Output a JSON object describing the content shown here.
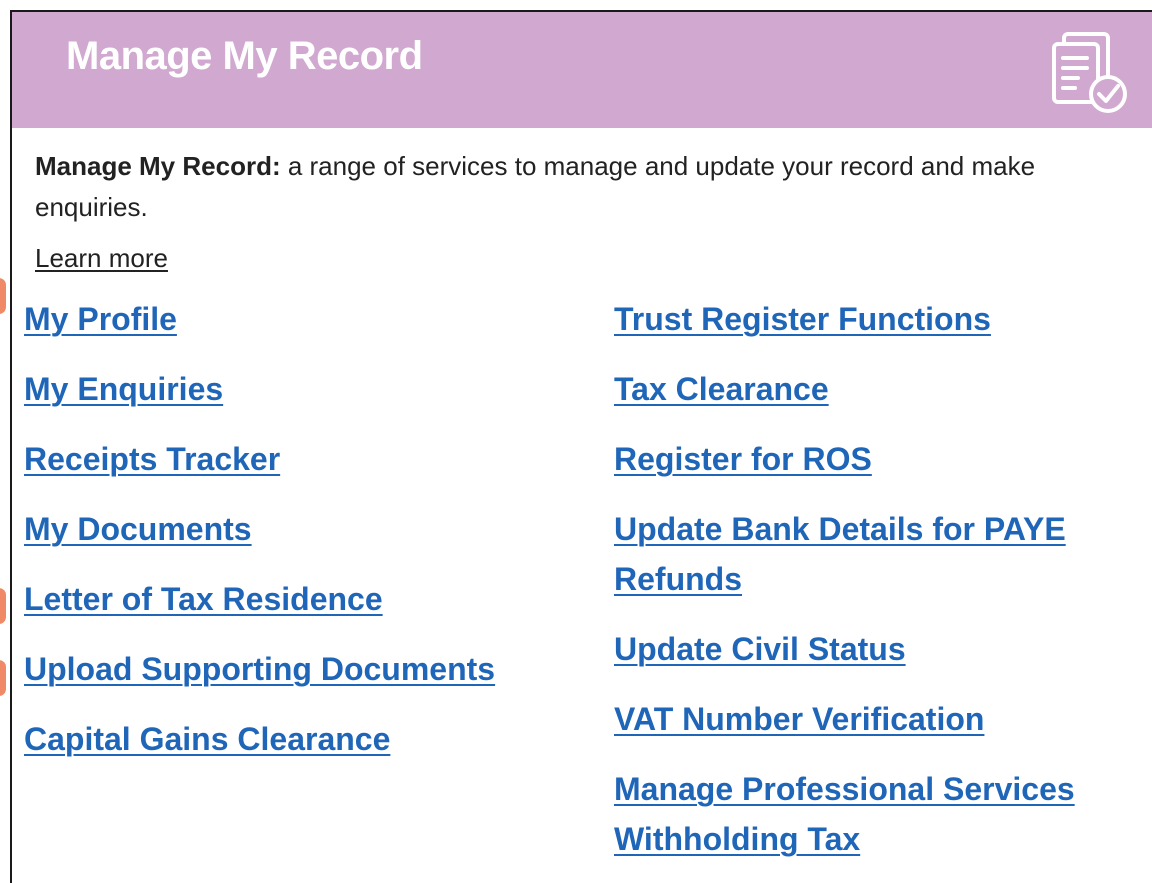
{
  "card": {
    "title": "Manage My Record",
    "icon": "document-checkmark-icon",
    "header_color": "#d0a8d0",
    "intro_label": "Manage My Record:",
    "intro_text": " a range of services to manage and update your record and make enquiries.",
    "learn_more": "Learn more"
  },
  "links": {
    "color": "#1f66b8",
    "left": [
      "My Profile",
      "My Enquiries",
      "Receipts Tracker",
      "My Documents",
      "Letter of Tax Residence",
      "Upload Supporting Documents",
      "Capital Gains Clearance"
    ],
    "right": [
      "Trust Register Functions",
      "Tax Clearance",
      "Register for ROS",
      "Update Bank Details for PAYE Refunds",
      "Update Civil Status",
      "VAT Number Verification",
      "Manage Professional Services Withholding Tax"
    ]
  }
}
